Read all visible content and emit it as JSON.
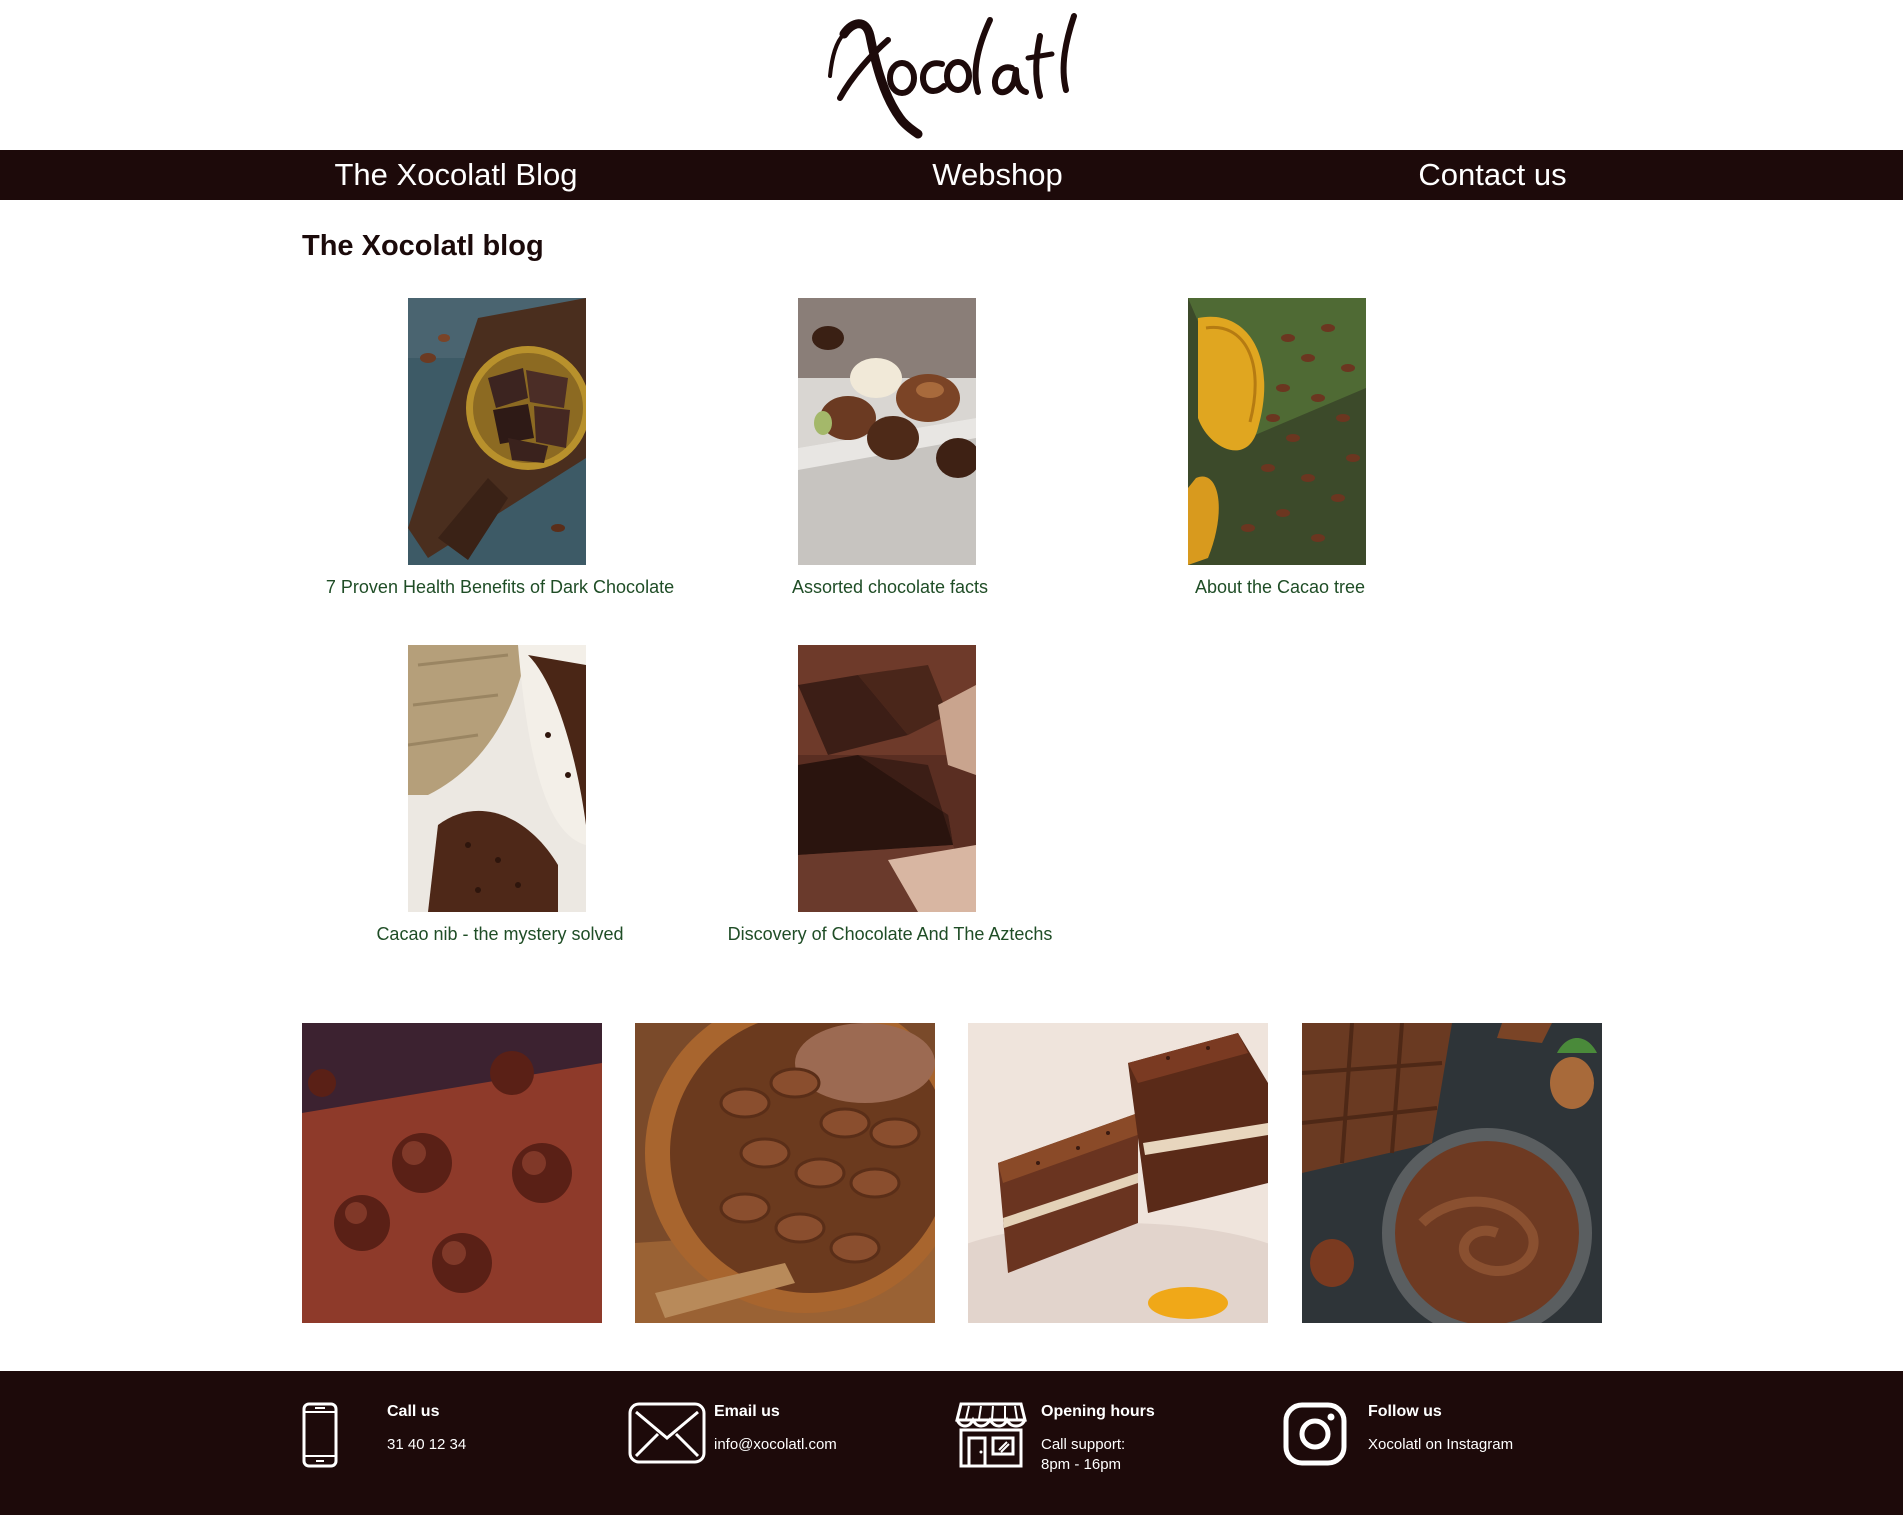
{
  "brand": {
    "logo_text": "Xocolatl"
  },
  "nav": {
    "items": [
      {
        "label": "The Xocolatl Blog"
      },
      {
        "label": "Webshop"
      },
      {
        "label": "Contact us"
      }
    ]
  },
  "main": {
    "title": "The Xocolatl blog",
    "posts": [
      {
        "title": "7 Proven Health Benefits of Dark Chocolate",
        "image": "dark-chocolate-chunks-in-brass-bowl"
      },
      {
        "title": "Assorted chocolate facts",
        "image": "assorted-pralines-in-white-box"
      },
      {
        "title": "About the Cacao tree",
        "image": "cacao-pod-and-beans"
      },
      {
        "title": "Cacao nib - the mystery solved",
        "image": "cacao-nibs-spilling-from-sack"
      },
      {
        "title": "Discovery of Chocolate And The Aztechs",
        "image": "broken-chocolate-bar-pieces"
      }
    ]
  },
  "gallery": {
    "images": [
      "cocoa-truffles",
      "cacao-beans-in-wooden-bowl",
      "chocolate-layer-cake-slice",
      "chocolate-bar-and-hazelnut-spread"
    ]
  },
  "footer": {
    "call": {
      "heading": "Call us",
      "text": "31 40 12 34",
      "icon": "phone-icon"
    },
    "email": {
      "heading": "Email us",
      "text": "info@xocolatl.com",
      "icon": "envelope-icon"
    },
    "hours": {
      "heading": "Opening hours",
      "line1": "Call support:",
      "line2": "8pm - 16pm",
      "icon": "store-icon"
    },
    "follow": {
      "heading": "Follow us",
      "text": "Xocolatl on Instagram",
      "icon": "instagram-icon"
    }
  },
  "colors": {
    "nav_background": "#1d0a0a",
    "footer_background": "#1d0a0a",
    "post_link": "#1f4d26",
    "heading": "#1b0a0a"
  }
}
